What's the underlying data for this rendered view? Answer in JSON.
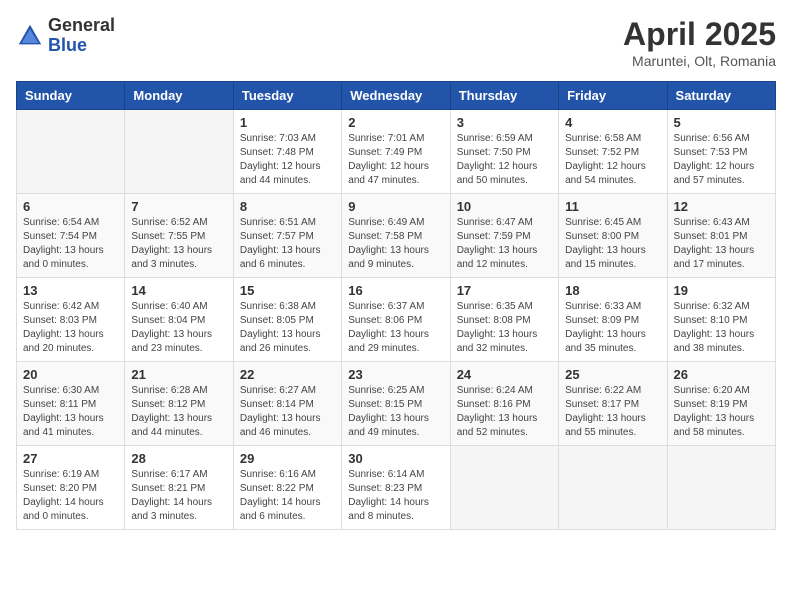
{
  "header": {
    "logo_general": "General",
    "logo_blue": "Blue",
    "month_title": "April 2025",
    "subtitle": "Maruntei, Olt, Romania"
  },
  "weekdays": [
    "Sunday",
    "Monday",
    "Tuesday",
    "Wednesday",
    "Thursday",
    "Friday",
    "Saturday"
  ],
  "weeks": [
    [
      {
        "day": "",
        "info": ""
      },
      {
        "day": "",
        "info": ""
      },
      {
        "day": "1",
        "info": "Sunrise: 7:03 AM\nSunset: 7:48 PM\nDaylight: 12 hours and 44 minutes."
      },
      {
        "day": "2",
        "info": "Sunrise: 7:01 AM\nSunset: 7:49 PM\nDaylight: 12 hours and 47 minutes."
      },
      {
        "day": "3",
        "info": "Sunrise: 6:59 AM\nSunset: 7:50 PM\nDaylight: 12 hours and 50 minutes."
      },
      {
        "day": "4",
        "info": "Sunrise: 6:58 AM\nSunset: 7:52 PM\nDaylight: 12 hours and 54 minutes."
      },
      {
        "day": "5",
        "info": "Sunrise: 6:56 AM\nSunset: 7:53 PM\nDaylight: 12 hours and 57 minutes."
      }
    ],
    [
      {
        "day": "6",
        "info": "Sunrise: 6:54 AM\nSunset: 7:54 PM\nDaylight: 13 hours and 0 minutes."
      },
      {
        "day": "7",
        "info": "Sunrise: 6:52 AM\nSunset: 7:55 PM\nDaylight: 13 hours and 3 minutes."
      },
      {
        "day": "8",
        "info": "Sunrise: 6:51 AM\nSunset: 7:57 PM\nDaylight: 13 hours and 6 minutes."
      },
      {
        "day": "9",
        "info": "Sunrise: 6:49 AM\nSunset: 7:58 PM\nDaylight: 13 hours and 9 minutes."
      },
      {
        "day": "10",
        "info": "Sunrise: 6:47 AM\nSunset: 7:59 PM\nDaylight: 13 hours and 12 minutes."
      },
      {
        "day": "11",
        "info": "Sunrise: 6:45 AM\nSunset: 8:00 PM\nDaylight: 13 hours and 15 minutes."
      },
      {
        "day": "12",
        "info": "Sunrise: 6:43 AM\nSunset: 8:01 PM\nDaylight: 13 hours and 17 minutes."
      }
    ],
    [
      {
        "day": "13",
        "info": "Sunrise: 6:42 AM\nSunset: 8:03 PM\nDaylight: 13 hours and 20 minutes."
      },
      {
        "day": "14",
        "info": "Sunrise: 6:40 AM\nSunset: 8:04 PM\nDaylight: 13 hours and 23 minutes."
      },
      {
        "day": "15",
        "info": "Sunrise: 6:38 AM\nSunset: 8:05 PM\nDaylight: 13 hours and 26 minutes."
      },
      {
        "day": "16",
        "info": "Sunrise: 6:37 AM\nSunset: 8:06 PM\nDaylight: 13 hours and 29 minutes."
      },
      {
        "day": "17",
        "info": "Sunrise: 6:35 AM\nSunset: 8:08 PM\nDaylight: 13 hours and 32 minutes."
      },
      {
        "day": "18",
        "info": "Sunrise: 6:33 AM\nSunset: 8:09 PM\nDaylight: 13 hours and 35 minutes."
      },
      {
        "day": "19",
        "info": "Sunrise: 6:32 AM\nSunset: 8:10 PM\nDaylight: 13 hours and 38 minutes."
      }
    ],
    [
      {
        "day": "20",
        "info": "Sunrise: 6:30 AM\nSunset: 8:11 PM\nDaylight: 13 hours and 41 minutes."
      },
      {
        "day": "21",
        "info": "Sunrise: 6:28 AM\nSunset: 8:12 PM\nDaylight: 13 hours and 44 minutes."
      },
      {
        "day": "22",
        "info": "Sunrise: 6:27 AM\nSunset: 8:14 PM\nDaylight: 13 hours and 46 minutes."
      },
      {
        "day": "23",
        "info": "Sunrise: 6:25 AM\nSunset: 8:15 PM\nDaylight: 13 hours and 49 minutes."
      },
      {
        "day": "24",
        "info": "Sunrise: 6:24 AM\nSunset: 8:16 PM\nDaylight: 13 hours and 52 minutes."
      },
      {
        "day": "25",
        "info": "Sunrise: 6:22 AM\nSunset: 8:17 PM\nDaylight: 13 hours and 55 minutes."
      },
      {
        "day": "26",
        "info": "Sunrise: 6:20 AM\nSunset: 8:19 PM\nDaylight: 13 hours and 58 minutes."
      }
    ],
    [
      {
        "day": "27",
        "info": "Sunrise: 6:19 AM\nSunset: 8:20 PM\nDaylight: 14 hours and 0 minutes."
      },
      {
        "day": "28",
        "info": "Sunrise: 6:17 AM\nSunset: 8:21 PM\nDaylight: 14 hours and 3 minutes."
      },
      {
        "day": "29",
        "info": "Sunrise: 6:16 AM\nSunset: 8:22 PM\nDaylight: 14 hours and 6 minutes."
      },
      {
        "day": "30",
        "info": "Sunrise: 6:14 AM\nSunset: 8:23 PM\nDaylight: 14 hours and 8 minutes."
      },
      {
        "day": "",
        "info": ""
      },
      {
        "day": "",
        "info": ""
      },
      {
        "day": "",
        "info": ""
      }
    ]
  ]
}
